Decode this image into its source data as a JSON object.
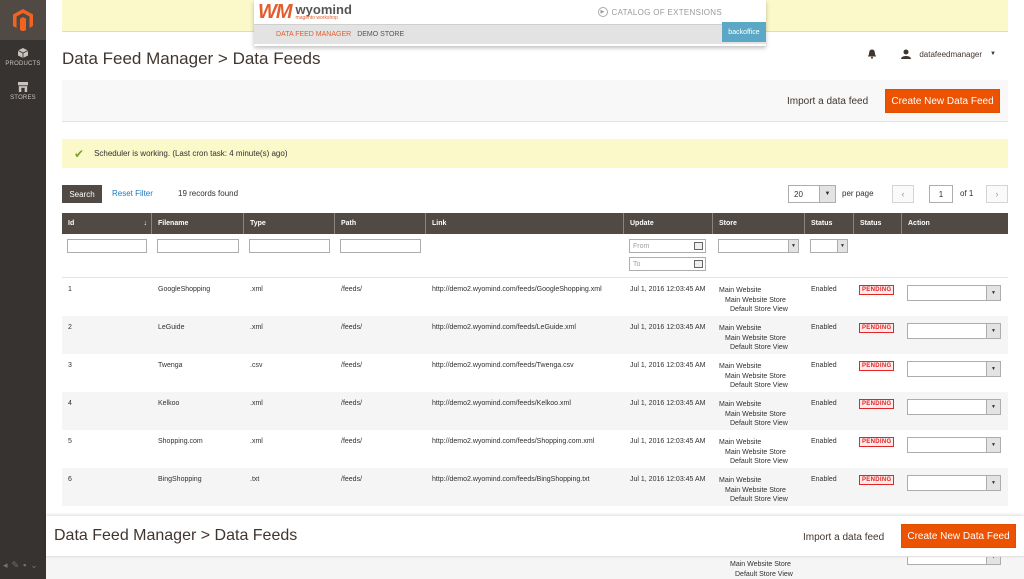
{
  "nav": {
    "items": [
      {
        "label": "PRODUCTS",
        "icon": "cube-icon"
      },
      {
        "label": "STORES",
        "icon": "store-icon"
      }
    ]
  },
  "banner": {
    "logo": "WM",
    "brand": "wyomind",
    "brand_sub": "magento workshop",
    "catalog": "CATALOG OF EXTENSIONS",
    "crumb_a": "DATA FEED MANAGER",
    "crumb_b": "DEMO STORE",
    "backoffice": "backoffice"
  },
  "header": {
    "title": "Data Feed Manager > Data Feeds",
    "username": "datafeedmanager"
  },
  "actions": {
    "import": "Import a data feed",
    "create": "Create New Data Feed"
  },
  "message": "Scheduler is working. (Last cron task: 4 minute(s) ago)",
  "grid_controls": {
    "search": "Search",
    "reset": "Reset Filter",
    "records": "19 records found",
    "per_page_value": "20",
    "per_page_label": "per page",
    "page": "1",
    "of": "of 1"
  },
  "columns": [
    "Id",
    "Filename",
    "Type",
    "Path",
    "Link",
    "Update",
    "Store",
    "Status",
    "Status",
    "Action"
  ],
  "filters": {
    "from": "From",
    "to": "To"
  },
  "rows": [
    {
      "id": "1",
      "filename": "GoogleShopping",
      "type": ".xml",
      "path": "/feeds/",
      "link": "http://demo2.wyomind.com/feeds/GoogleShopping.xml",
      "update": "Jul 1, 2016 12:03:45 AM",
      "store1": "Main Website",
      "store2": "Main Website Store",
      "store3": "Default Store View",
      "status": "Enabled",
      "badge": "PENDING"
    },
    {
      "id": "2",
      "filename": "LeGuide",
      "type": ".xml",
      "path": "/feeds/",
      "link": "http://demo2.wyomind.com/feeds/LeGuide.xml",
      "update": "Jul 1, 2016 12:03:45 AM",
      "store1": "Main Website",
      "store2": "Main Website Store",
      "store3": "Default Store View",
      "status": "Enabled",
      "badge": "PENDING"
    },
    {
      "id": "3",
      "filename": "Twenga",
      "type": ".csv",
      "path": "/feeds/",
      "link": "http://demo2.wyomind.com/feeds/Twenga.csv",
      "update": "Jul 1, 2016 12:03:45 AM",
      "store1": "Main Website",
      "store2": "Main Website Store",
      "store3": "Default Store View",
      "status": "Enabled",
      "badge": "PENDING"
    },
    {
      "id": "4",
      "filename": "Kelkoo",
      "type": ".xml",
      "path": "/feeds/",
      "link": "http://demo2.wyomind.com/feeds/Kelkoo.xml",
      "update": "Jul 1, 2016 12:03:45 AM",
      "store1": "Main Website",
      "store2": "Main Website Store",
      "store3": "Default Store View",
      "status": "Enabled",
      "badge": "PENDING"
    },
    {
      "id": "5",
      "filename": "Shopping.com",
      "type": ".xml",
      "path": "/feeds/",
      "link": "http://demo2.wyomind.com/feeds/Shopping.com.xml",
      "update": "Jul 1, 2016 12:03:45 AM",
      "store1": "Main Website",
      "store2": "Main Website Store",
      "store3": "Default Store View",
      "status": "Enabled",
      "badge": "PENDING"
    },
    {
      "id": "6",
      "filename": "BingShopping",
      "type": ".txt",
      "path": "/feeds/",
      "link": "http://demo2.wyomind.com/feeds/BingShopping.txt",
      "update": "Jul 1, 2016 12:03:45 AM",
      "store1": "Main Website",
      "store2": "Main Website Store",
      "store3": "Default Store View",
      "status": "Enabled",
      "badge": "PENDING"
    }
  ],
  "bottom_store": [
    "Main Website Store",
    "Default Store View"
  ]
}
